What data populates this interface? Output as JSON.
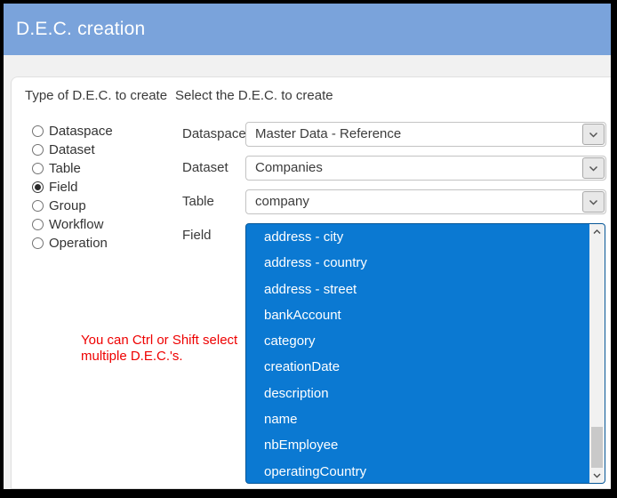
{
  "window": {
    "title": "D.E.C. creation"
  },
  "colors": {
    "header_blue": "#7aa3db",
    "selection_blue": "#0b79d2",
    "hint_red": "#ee0000"
  },
  "left_panel": {
    "heading": "Type of D.E.C. to create",
    "options": [
      {
        "label": "Dataspace",
        "selected": false
      },
      {
        "label": "Dataset",
        "selected": false
      },
      {
        "label": "Table",
        "selected": false
      },
      {
        "label": "Field",
        "selected": true
      },
      {
        "label": "Group",
        "selected": false
      },
      {
        "label": "Workflow",
        "selected": false
      },
      {
        "label": "Operation",
        "selected": false
      }
    ],
    "hint": {
      "line1": "You can Ctrl or Shift select",
      "line2": "multiple D.E.C.'s."
    }
  },
  "right_panel": {
    "heading": "Select the D.E.C. to create",
    "selects": [
      {
        "label": "Dataspace",
        "value": "Master Data - Reference"
      },
      {
        "label": "Dataset",
        "value": "Companies"
      },
      {
        "label": "Table",
        "value": "company"
      }
    ],
    "field_list": {
      "label": "Field",
      "selection": "all",
      "items": [
        "address - city",
        "address - country",
        "address - street",
        "bankAccount",
        "category",
        "creationDate",
        "description",
        "name",
        "nbEmployee",
        "operatingCountry"
      ]
    }
  }
}
